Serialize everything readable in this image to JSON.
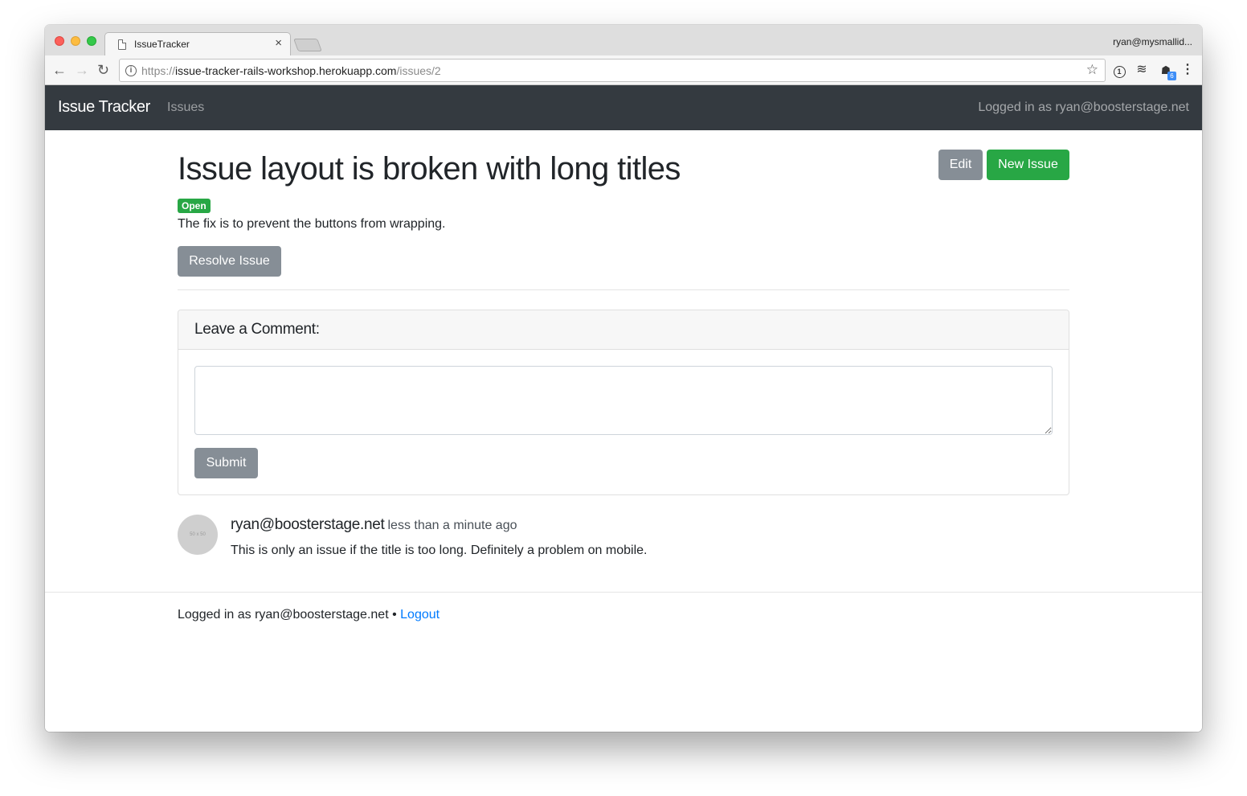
{
  "browser": {
    "tab_title": "IssueTracker",
    "tab_close": "×",
    "profile_name": "ryan@mysmallid...",
    "url_scheme": "https://",
    "url_host": "issue-tracker-rails-workshop.herokuapp.com",
    "url_path": "/issues/2",
    "extension_badge": "6"
  },
  "navbar": {
    "brand": "Issue Tracker",
    "link_issues": "Issues",
    "user_text": "Logged in as ryan@boosterstage.net"
  },
  "issue": {
    "title": "Issue layout is broken with long titles",
    "status": "Open",
    "description": "The fix is to prevent the buttons from wrapping.",
    "edit_label": "Edit",
    "new_issue_label": "New Issue",
    "resolve_label": "Resolve Issue"
  },
  "comment_form": {
    "header": "Leave a Comment:",
    "body_value": "",
    "submit_label": "Submit"
  },
  "comments": [
    {
      "avatar_text": "50 x 50",
      "author": "ryan@boosterstage.net",
      "time": "less than a minute ago",
      "body": "This is only an issue if the title is too long. Definitely a problem on mobile."
    }
  ],
  "footer": {
    "text": "Logged in as ryan@boosterstage.net •",
    "logout_label": "Logout"
  },
  "colors": {
    "navbar_bg": "#343a40",
    "success": "#28a745",
    "secondary": "#868e96",
    "link": "#007bff"
  }
}
